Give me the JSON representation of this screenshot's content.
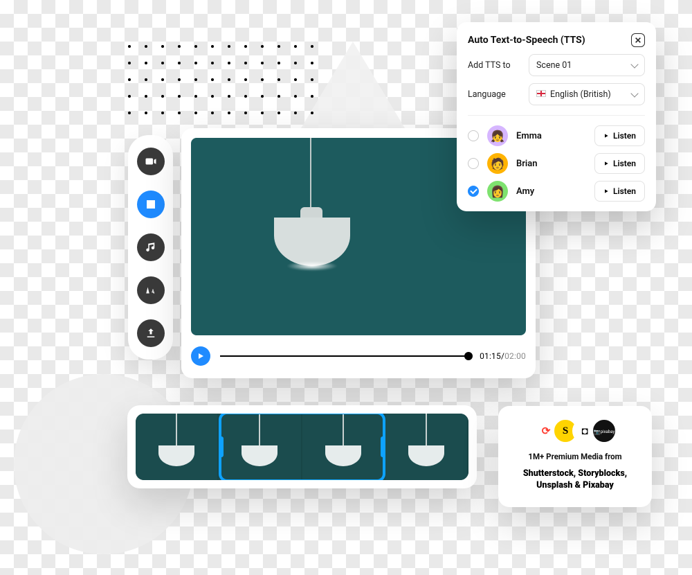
{
  "rail": {
    "items": [
      {
        "id": "video",
        "name": "camera-icon",
        "active": false
      },
      {
        "id": "image",
        "name": "image-icon",
        "active": true
      },
      {
        "id": "music",
        "name": "music-icon",
        "active": false
      },
      {
        "id": "text",
        "name": "text-icon",
        "active": false
      },
      {
        "id": "upload",
        "name": "upload-icon",
        "active": false
      }
    ]
  },
  "player": {
    "current_time": "01:15",
    "total_time": "02:00",
    "separator": "/"
  },
  "tts": {
    "title": "Auto Text-to-Speech (TTS)",
    "add_to_label": "Add TTS to",
    "scene_value": "Scene 01",
    "language_label": "Language",
    "language_value": "English (British)",
    "listen_label": "Listen",
    "voices": [
      {
        "name": "Emma",
        "selected": false,
        "avatar_color": "purple"
      },
      {
        "name": "Brian",
        "selected": false,
        "avatar_color": "orange"
      },
      {
        "name": "Amy",
        "selected": true,
        "avatar_color": "green"
      }
    ]
  },
  "sources": {
    "subtitle": "1M+ Premium Media from",
    "providers": "Shutterstock, Storyblocks, Unsplash & Pixabay",
    "logos": [
      {
        "id": "shutterstock",
        "glyph": "⟲"
      },
      {
        "id": "storyblocks",
        "glyph": "S"
      },
      {
        "id": "unsplash",
        "glyph": "⏍"
      },
      {
        "id": "pixabay",
        "glyph": "📷\npixabay"
      }
    ]
  },
  "timeline": {
    "thumb_count": 4,
    "selection_start_pct": 25,
    "selection_width_pct": 50
  }
}
